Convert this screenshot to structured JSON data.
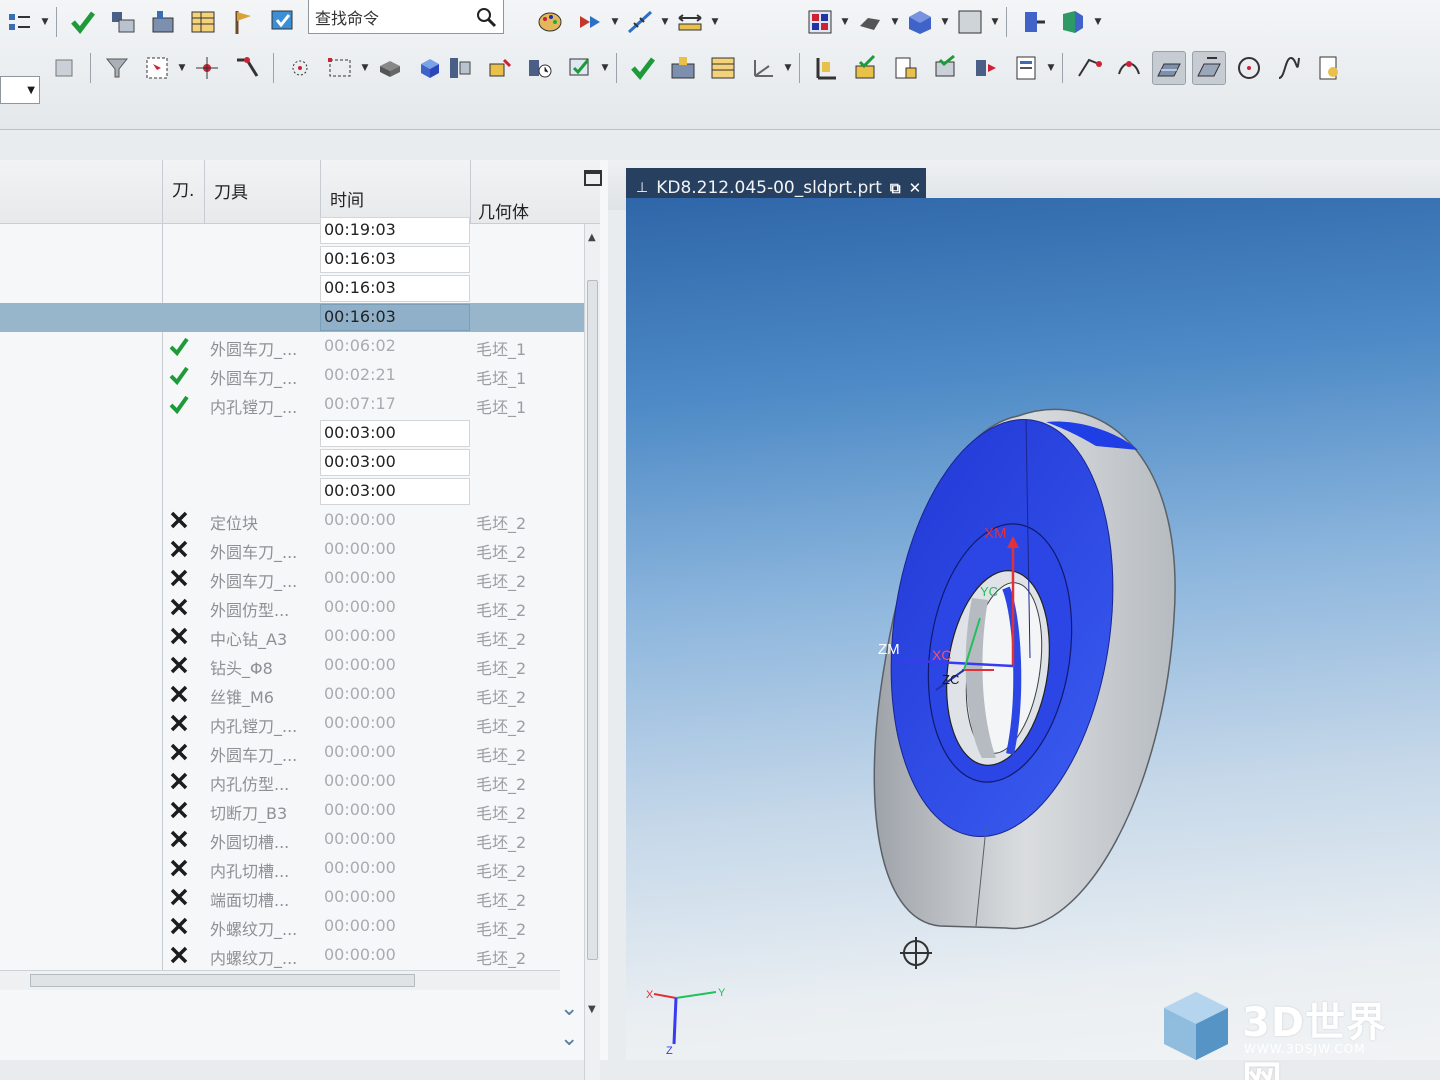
{
  "toolbar": {
    "search_placeholder": "查找命令",
    "buttons_row1": [
      "program-group-icon",
      "check-icon",
      "tool-library-icon",
      "geometry-icon",
      "operation-table-icon",
      "flag-icon",
      "verify-icon",
      "document-icon"
    ],
    "buttons_row2": [
      "palette-icon",
      "shuffle-icon",
      "ruler-icon",
      "measure-icon",
      "grid-icon",
      "bin-icon",
      "cube-icon",
      "rectangle-icon",
      "arrow-right-icon",
      "arrow-down-icon",
      "dimension-icon",
      "snap-icon",
      "point-icon",
      "curve-icon",
      "report-icon"
    ]
  },
  "navigator": {
    "columns": {
      "tool_number": "刀.",
      "tool": "刀具",
      "time": "时间",
      "geometry": "几何体"
    },
    "rows": [
      {
        "status": "",
        "tool": "",
        "time": "00:19:03",
        "geometry": "",
        "selected": false,
        "dim": false
      },
      {
        "status": "",
        "tool": "",
        "time": "00:16:03",
        "geometry": "",
        "selected": false,
        "dim": false
      },
      {
        "status": "",
        "tool": "",
        "time": "00:16:03",
        "geometry": "",
        "selected": false,
        "dim": false
      },
      {
        "status": "",
        "tool": "",
        "time": "00:16:03",
        "geometry": "",
        "selected": true,
        "dim": false
      },
      {
        "status": "check",
        "tool": "外圆车刀_...",
        "time": "00:06:02",
        "geometry": "毛坯_1",
        "selected": false,
        "dim": true
      },
      {
        "status": "check",
        "tool": "外圆车刀_...",
        "time": "00:02:21",
        "geometry": "毛坯_1",
        "selected": false,
        "dim": true
      },
      {
        "status": "check",
        "tool": "内孔镗刀_...",
        "time": "00:07:17",
        "geometry": "毛坯_1",
        "selected": false,
        "dim": true
      },
      {
        "status": "",
        "tool": "",
        "time": "00:03:00",
        "geometry": "",
        "selected": false,
        "dim": false
      },
      {
        "status": "",
        "tool": "",
        "time": "00:03:00",
        "geometry": "",
        "selected": false,
        "dim": false
      },
      {
        "status": "",
        "tool": "",
        "time": "00:03:00",
        "geometry": "",
        "selected": false,
        "dim": false
      },
      {
        "status": "cross",
        "tool": "定位块",
        "time": "00:00:00",
        "geometry": "毛坯_2",
        "selected": false,
        "dim": true
      },
      {
        "status": "cross",
        "tool": "外圆车刀_...",
        "time": "00:00:00",
        "geometry": "毛坯_2",
        "selected": false,
        "dim": true
      },
      {
        "status": "cross",
        "tool": "外圆车刀_...",
        "time": "00:00:00",
        "geometry": "毛坯_2",
        "selected": false,
        "dim": true
      },
      {
        "status": "cross",
        "tool": "外圆仿型...",
        "time": "00:00:00",
        "geometry": "毛坯_2",
        "selected": false,
        "dim": true
      },
      {
        "status": "cross",
        "tool": "中心钻_A3",
        "time": "00:00:00",
        "geometry": "毛坯_2",
        "selected": false,
        "dim": true
      },
      {
        "status": "cross",
        "tool": "钻头_Φ8",
        "time": "00:00:00",
        "geometry": "毛坯_2",
        "selected": false,
        "dim": true
      },
      {
        "status": "cross",
        "tool": "丝锥_M6",
        "time": "00:00:00",
        "geometry": "毛坯_2",
        "selected": false,
        "dim": true
      },
      {
        "status": "cross",
        "tool": "内孔镗刀_...",
        "time": "00:00:00",
        "geometry": "毛坯_2",
        "selected": false,
        "dim": true
      },
      {
        "status": "cross",
        "tool": "外圆车刀_...",
        "time": "00:00:00",
        "geometry": "毛坯_2",
        "selected": false,
        "dim": true
      },
      {
        "status": "cross",
        "tool": "内孔仿型...",
        "time": "00:00:00",
        "geometry": "毛坯_2",
        "selected": false,
        "dim": true
      },
      {
        "status": "cross",
        "tool": "切断刀_B3",
        "time": "00:00:00",
        "geometry": "毛坯_2",
        "selected": false,
        "dim": true
      },
      {
        "status": "cross",
        "tool": "外圆切槽...",
        "time": "00:00:00",
        "geometry": "毛坯_2",
        "selected": false,
        "dim": true
      },
      {
        "status": "cross",
        "tool": "内孔切槽...",
        "time": "00:00:00",
        "geometry": "毛坯_2",
        "selected": false,
        "dim": true
      },
      {
        "status": "cross",
        "tool": "端面切槽...",
        "time": "00:00:00",
        "geometry": "毛坯_2",
        "selected": false,
        "dim": true
      },
      {
        "status": "cross",
        "tool": "外螺纹刀_...",
        "time": "00:00:00",
        "geometry": "毛坯_2",
        "selected": false,
        "dim": true
      },
      {
        "status": "cross",
        "tool": "内螺纹刀_...",
        "time": "00:00:00",
        "geometry": "毛坯_2",
        "selected": false,
        "dim": true
      }
    ]
  },
  "graphics": {
    "tab_title": "KD8.212.045-00_sldprt.prt",
    "axis_labels": {
      "xm": "XM",
      "zm": "ZM",
      "xc": "XC",
      "yc": "YC",
      "zc": "ZC"
    },
    "triad_labels": {
      "x": "X",
      "y": "Y",
      "z": "Z"
    },
    "colors": {
      "selected_face": "#2d47e8",
      "part_body": "#c9cdd2",
      "viewport_top": "#2f66a9",
      "viewport_bottom": "#f1f3f4"
    }
  },
  "watermark": {
    "title": "3D世界网",
    "url": "WWW.3DSJW.COM"
  }
}
